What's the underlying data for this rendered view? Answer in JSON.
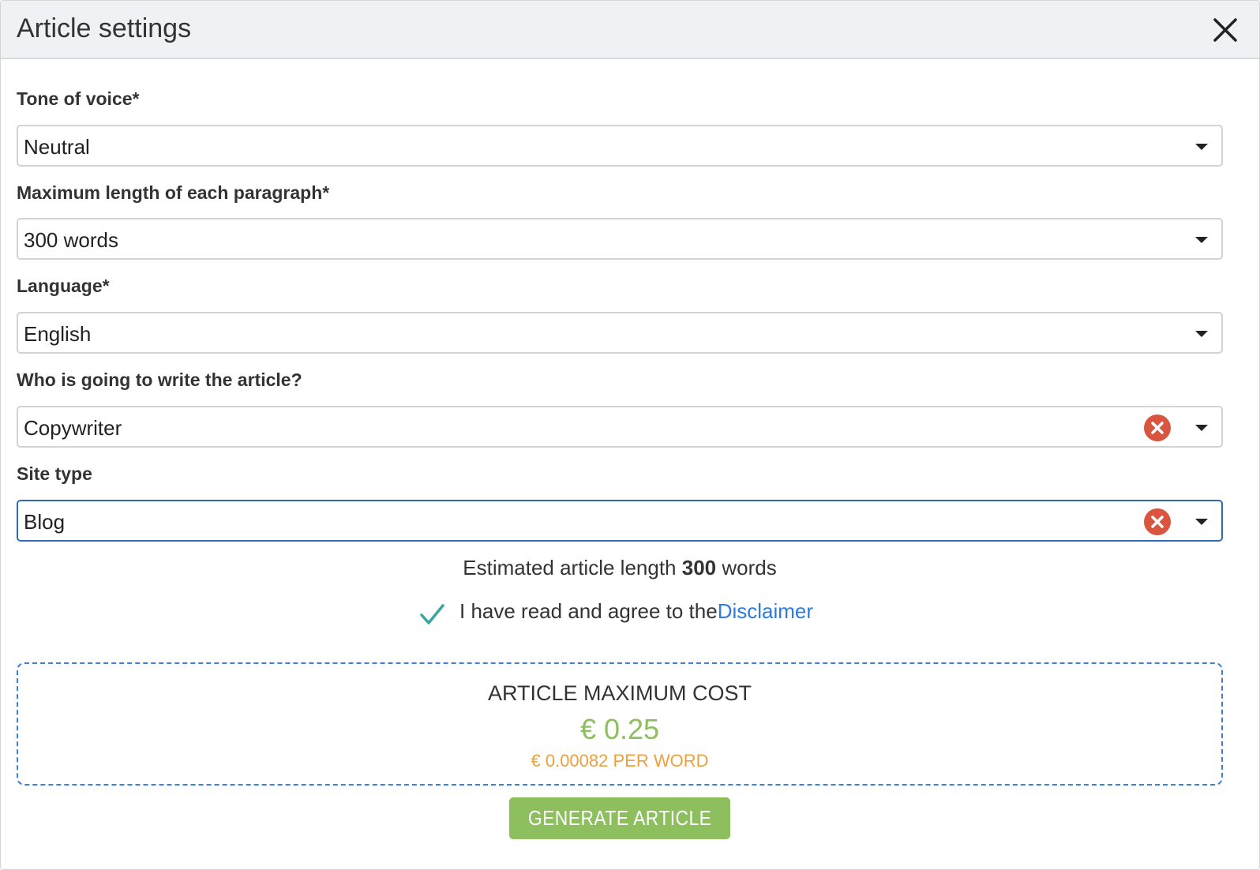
{
  "dialog": {
    "title": "Article settings",
    "close_icon": "close-icon"
  },
  "fields": {
    "tone": {
      "label": "Tone of voice*",
      "value": "Neutral"
    },
    "paragraph_length": {
      "label": "Maximum length of each paragraph*",
      "value": "300 words"
    },
    "language": {
      "label": "Language*",
      "value": "English"
    },
    "writer": {
      "label": "Who is going to write the article?",
      "value": "Copywriter",
      "clearable": true
    },
    "site_type": {
      "label": "Site type",
      "value": "Blog",
      "clearable": true,
      "focused": true
    }
  },
  "estimate": {
    "prefix": "Estimated article length",
    "value": "300",
    "suffix": "words"
  },
  "agreement": {
    "checked": true,
    "text": "I have read and agree to the",
    "link_text": "Disclaimer"
  },
  "cost": {
    "title": "ARTICLE MAXIMUM COST",
    "value": "€ 0.25",
    "per_word": "€ 0.00082 PER WORD"
  },
  "actions": {
    "generate_label": "GENERATE ARTICLE"
  },
  "colors": {
    "header_bg": "#eff1f5",
    "focus_border": "#2f6bb5",
    "clear_red": "#d9553f",
    "check_teal": "#3aa6a0",
    "link_blue": "#2c7be5",
    "cost_border": "#3f7fdb",
    "cost_green": "#8dbf5e",
    "per_word_orange": "#eea03c",
    "button_green": "#8dbf5e"
  }
}
